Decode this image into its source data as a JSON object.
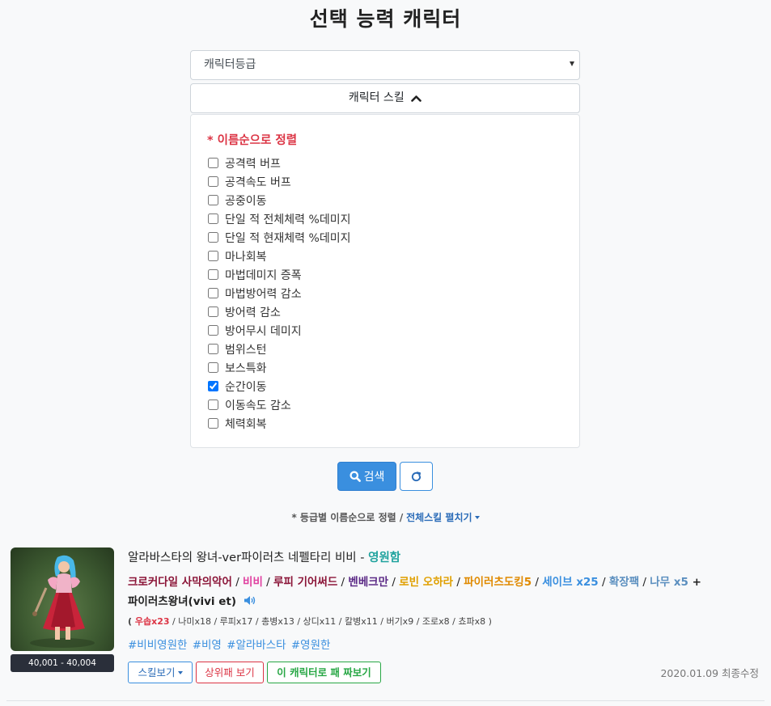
{
  "page": {
    "title": "선택 능력 캐릭터"
  },
  "grade_select": {
    "value": "캐릭터등급"
  },
  "skill_toggle": {
    "label": "캐릭터 스킬"
  },
  "skill_panel": {
    "sort_note": "* 이름순으로 정렬",
    "skills": [
      {
        "label": "공격력 버프",
        "checked": false
      },
      {
        "label": "공격속도 버프",
        "checked": false
      },
      {
        "label": "공중이동",
        "checked": false
      },
      {
        "label": "단일 적 전체체력 %데미지",
        "checked": false
      },
      {
        "label": "단일 적 현재체력 %데미지",
        "checked": false
      },
      {
        "label": "마나회복",
        "checked": false
      },
      {
        "label": "마법데미지 증폭",
        "checked": false
      },
      {
        "label": "마법방어력 감소",
        "checked": false
      },
      {
        "label": "방어력 감소",
        "checked": false
      },
      {
        "label": "방어무시 데미지",
        "checked": false
      },
      {
        "label": "범위스턴",
        "checked": false
      },
      {
        "label": "보스특화",
        "checked": false
      },
      {
        "label": "순간이동",
        "checked": true
      },
      {
        "label": "이동속도 감소",
        "checked": false
      },
      {
        "label": "체력회복",
        "checked": false
      }
    ]
  },
  "actions": {
    "search_label": "검색"
  },
  "sort_info": {
    "text": "* 등급별 이름순으로 정렬 /",
    "expand_link": "전체스킬 펼치기"
  },
  "character": {
    "price_range": "40,001 - 40,004",
    "name": "알라바스타의 왕녀-ver파이러츠 네펠타리 비비",
    "dash": " - ",
    "grade_tag": "영원함",
    "team": {
      "t1": "크로커다일 사막의악어",
      "t2": "비비",
      "t3": "루피 기어써드",
      "t4": "벤베크만",
      "t5": "로빈 오하라",
      "t6": "파이러츠도킹5",
      "t7": "세이브 x25",
      "t8": "확장팩",
      "t9": "나무 x5",
      "plus": " +",
      "t10": "파이러츠왕녀(vivi et)",
      "sep": " / "
    },
    "sub_units": {
      "open": "( ",
      "hi": "우솝x23",
      "rest": " / 나미x18 / 루피x17 / 총병x13 / 상디x11 / 칼병x11 / 버기x9 / 조로x8 / 쵸파x8 )"
    },
    "hashtags": "#비비영원한 #비영 #알라바스타 #영원한",
    "buttons": {
      "skill_view": "스킬보기",
      "upper_view": "상위패 보기",
      "build_with": "이 캐릭터로 패 짜보기"
    },
    "modified": "2020.01.09 최종수정"
  },
  "colors": {
    "primary": "#3a8fdf",
    "danger": "#dc3545",
    "success": "#28a745",
    "teal": "#20a39e"
  }
}
